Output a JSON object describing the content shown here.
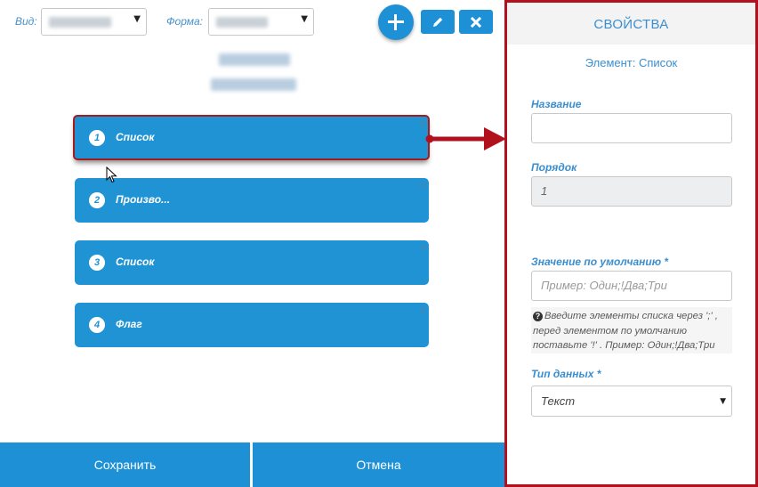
{
  "toolbar": {
    "view_label": "Вид:",
    "form_label": "Форма:",
    "add_icon": "plus-icon",
    "edit_icon": "pencil-icon",
    "delete_icon": "close-icon"
  },
  "elements": [
    {
      "number": "1",
      "label": "Список"
    },
    {
      "number": "2",
      "label": "Произво..."
    },
    {
      "number": "3",
      "label": "Список"
    },
    {
      "number": "4",
      "label": "Флаг"
    }
  ],
  "remove_glyph": "×",
  "footer": {
    "save_label": "Сохранить",
    "cancel_label": "Отмена"
  },
  "properties": {
    "title": "СВОЙСТВА",
    "element_caption": "Элемент: Список",
    "name_label": "Название",
    "name_value": "",
    "order_label": "Порядок",
    "order_value": "1",
    "default_label": "Значение по умолчанию *",
    "default_placeholder": "Пример: Один;!Два;Три",
    "hint_line1": "Введите элементы списка через ';' ,",
    "hint_line2": "перед элементом по умолчанию",
    "hint_line3": "поставьте '!' . Пример: Один;!Два;Три",
    "datatype_label": "Тип данных *",
    "datatype_value": "Текст"
  },
  "colors": {
    "accent": "#1e90d6",
    "highlight_border": "#b3101e",
    "label_text": "#3b8ecf"
  }
}
